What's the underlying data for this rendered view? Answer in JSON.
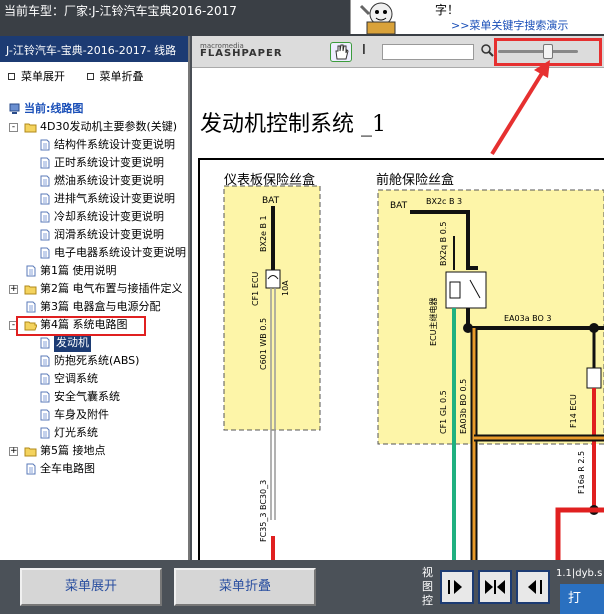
{
  "top": {
    "current_model": "当前车型：厂家:J-江铃汽车宝典2016-2017"
  },
  "help": {
    "line1": "字！",
    "link": ">>菜单关键字搜索演示"
  },
  "left": {
    "title": "J-江铃汽车-宝典-2016-2017- 线路",
    "expand_all": "菜单展开",
    "collapse_all": "菜单折叠",
    "tree": [
      {
        "label": "当前:线路图",
        "level": 0,
        "type": "root"
      },
      {
        "label": "4D30发动机主要参数(关键)",
        "level": 1,
        "type": "folder",
        "exp": "-"
      },
      {
        "label": "结构件系统设计变更说明",
        "level": 2,
        "type": "doc"
      },
      {
        "label": "正时系统设计变更说明",
        "level": 2,
        "type": "doc"
      },
      {
        "label": "燃油系统设计变更说明",
        "level": 2,
        "type": "doc"
      },
      {
        "label": "进排气系统设计变更说明",
        "level": 2,
        "type": "doc"
      },
      {
        "label": "冷却系统设计变更说明",
        "level": 2,
        "type": "doc"
      },
      {
        "label": "润滑系统设计变更说明",
        "level": 2,
        "type": "doc"
      },
      {
        "label": "电子电器系统设计变更说明",
        "level": 2,
        "type": "doc"
      },
      {
        "label": "第1篇 使用说明",
        "level": 1,
        "type": "doc"
      },
      {
        "label": "第2篇 电气布置与接插件定义",
        "level": 1,
        "type": "folder",
        "exp": "+"
      },
      {
        "label": "第3篇 电器盒与电源分配",
        "level": 1,
        "type": "doc"
      },
      {
        "label": "第4篇 系统电路图",
        "level": 1,
        "type": "folder-open",
        "exp": "-"
      },
      {
        "label": "发动机",
        "level": 2,
        "type": "doc",
        "selected": true
      },
      {
        "label": "防抱死系统(ABS)",
        "level": 2,
        "type": "doc"
      },
      {
        "label": "空调系统",
        "level": 2,
        "type": "doc"
      },
      {
        "label": "安全气囊系统",
        "level": 2,
        "type": "doc"
      },
      {
        "label": "车身及附件",
        "level": 2,
        "type": "doc"
      },
      {
        "label": "灯光系统",
        "level": 2,
        "type": "doc"
      },
      {
        "label": "第5篇 接地点",
        "level": 1,
        "type": "folder",
        "exp": "+"
      },
      {
        "label": "全车电路图",
        "level": 1,
        "type": "doc"
      }
    ]
  },
  "viewer": {
    "logo_top": "macromedia",
    "logo_main": "FLASHPAPER",
    "doc_title": "发动机控制系统 _1"
  },
  "diagram": {
    "box1_title": "仪表板保险丝盒",
    "box2_title": "前舱保险丝盒",
    "bat1": "BAT",
    "bat2": "BAT",
    "w_bx2e": "BX2e B 1",
    "w_bx2c": "BX2c B 3",
    "w_bx2q": "BX2q B 0.5",
    "cf1_label": "CF1 ECU",
    "cf1_amp": "10A",
    "relay_label": "ECU主继电器",
    "w_c601": "C601 WB 0.5",
    "w_ea03a": "EA03a BO 3",
    "w_cf1gl": "CF1 GL 0.5",
    "w_ea03b": "EA03b BO 0.5",
    "f14_label": "F14 ECU",
    "w_f16a": "F16a R 2.5",
    "w_fc35": "FC35_3 BC30_3"
  },
  "bottom": {
    "expand_btn": "菜单展开",
    "collapse_btn": "菜单折叠",
    "view_ctrl": "视图控",
    "id_text": "1.1|dyb.s",
    "print": "打"
  }
}
